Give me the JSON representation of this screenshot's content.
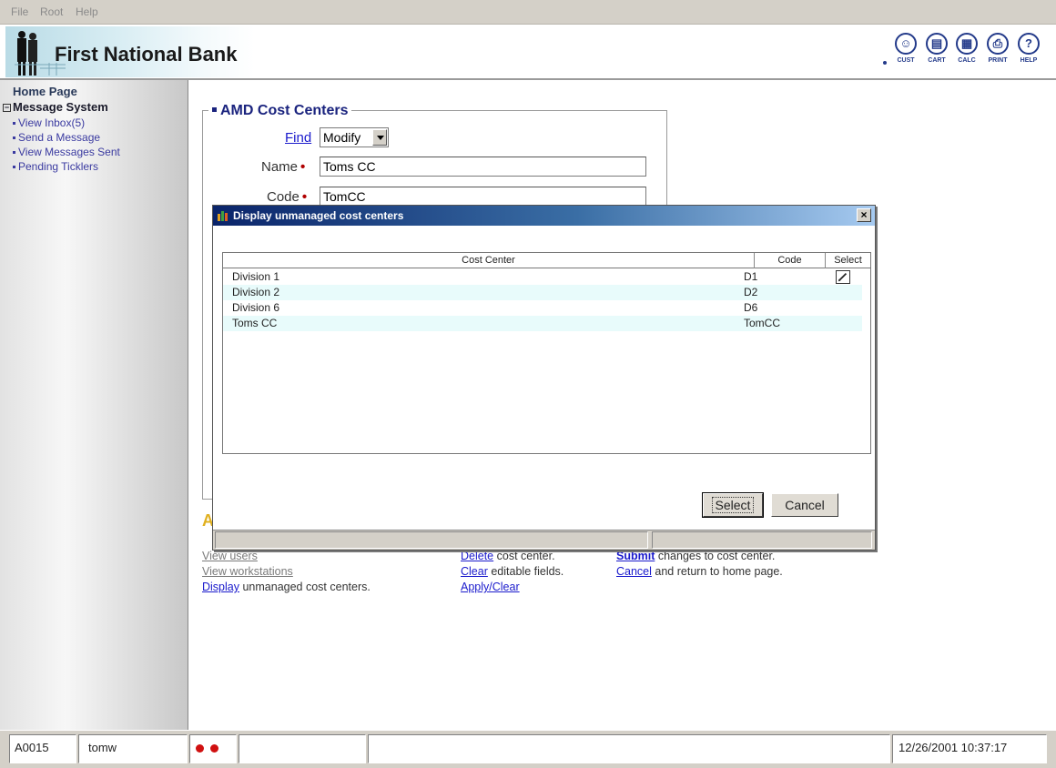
{
  "menu": [
    "File",
    "Root",
    "Help"
  ],
  "header": {
    "bank_name": "First National Bank",
    "tools": [
      {
        "label": "CUST",
        "glyph": "☺",
        "icon": "customer-icon"
      },
      {
        "label": "CART",
        "glyph": "▤",
        "icon": "cart-icon"
      },
      {
        "label": "CALC",
        "glyph": "▦",
        "icon": "calculator-icon"
      },
      {
        "label": "PRINT",
        "glyph": "⎙",
        "icon": "print-icon"
      },
      {
        "label": "HELP",
        "glyph": "?",
        "icon": "help-icon"
      }
    ]
  },
  "sidebar": {
    "home": "Home Page",
    "section": "Message System",
    "items": [
      "View Inbox(5)",
      "Send a Message",
      "View Messages Sent",
      "Pending Ticklers"
    ]
  },
  "form": {
    "legend": "AMD Cost Centers",
    "find_label": "Find",
    "mode_value": "Modify",
    "name_label": "Name",
    "name_value": "Toms CC",
    "code_label": "Code",
    "code_value": "TomCC",
    "hidden_letter": "A"
  },
  "links": {
    "view_users": "View users",
    "view_workstations": "View workstations",
    "display_link": "Display",
    "display_rest": "unmanaged cost centers.",
    "delete_link": "Delete",
    "delete_rest": "cost center.",
    "clear_link": "Clear",
    "clear_rest": "editable fields.",
    "apply_clear": "Apply/Clear",
    "submit_link": "Submit",
    "submit_rest": "changes to cost center.",
    "cancel_link": "Cancel",
    "cancel_rest": "and return to home page."
  },
  "dialog": {
    "title": "Display unmanaged cost centers",
    "close_glyph": "×",
    "columns": [
      "Cost Center",
      "Code",
      "Select"
    ],
    "rows": [
      {
        "name": "Division 1",
        "code": "D1"
      },
      {
        "name": "Division 2",
        "code": "D2"
      },
      {
        "name": "Division 6",
        "code": "D6"
      },
      {
        "name": "Toms CC",
        "code": "TomCC"
      }
    ],
    "select_button": "Select",
    "cancel_button": "Cancel"
  },
  "status": {
    "account": "A0015",
    "user": "tomw",
    "datetime": "12/26/2001 10:37:17"
  }
}
